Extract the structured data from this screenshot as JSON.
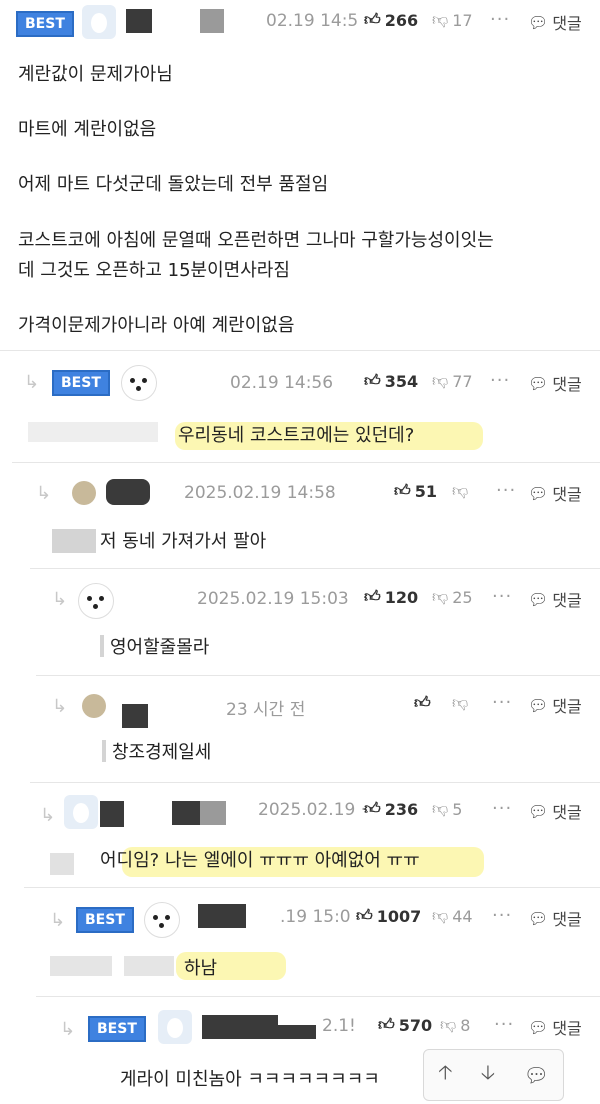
{
  "comments": [
    {
      "badge": "BEST",
      "time": "02.19 14:5",
      "likes": "266",
      "dislikes": "17",
      "more": "···",
      "reply": "댓글",
      "lines": [
        "계란값이 문제가아님",
        "마트에 계란이없음",
        "어제 마트 다섯군데 돌았는데 전부 품절임",
        "코스트코에 아침에 문열때 오픈런하면 그나마 구할가능성이잇는",
        "데 그것도 오픈하고 15분이면사라짐",
        "가격이문제가아니라 아예 계란이없음"
      ]
    },
    {
      "badge": "BEST",
      "time": "02.19 14:56",
      "likes": "354",
      "dislikes": "77",
      "more": "···",
      "reply": "댓글",
      "text": "우리동네 코스트코에는 있던데?"
    },
    {
      "time": "2025.02.19 14:58",
      "likes": "51",
      "dislikes": "",
      "more": "···",
      "reply": "댓글",
      "text": "저 동네 가져가서 팔아"
    },
    {
      "time": "2025.02.19 15:03",
      "likes": "120",
      "dislikes": "25",
      "more": "···",
      "reply": "댓글",
      "text": "영어할줄몰라"
    },
    {
      "time": "23 시간 전",
      "likes": "",
      "dislikes": "",
      "more": "···",
      "reply": "댓글",
      "text": "창조경제일세"
    },
    {
      "time": "2025.02.19 ·",
      "likes": "236",
      "dislikes": "5",
      "more": "···",
      "reply": "댓글",
      "text": "어디임? 나는 엘에이 ㅠㅠㅠ 아예없어 ㅠㅠ"
    },
    {
      "badge": "BEST",
      "time": ".19 15:0",
      "likes": "1007",
      "dislikes": "44",
      "more": "···",
      "reply": "댓글",
      "text": "하남"
    },
    {
      "badge": "BEST",
      "time": "2.1!",
      "likes": "570",
      "dislikes": "8",
      "more": "···",
      "reply": "댓글",
      "text": "게라이 미친놈아 ㅋㅋㅋㅋㅋㅋㅋㅋ"
    }
  ],
  "icons": {
    "like": "thumbs-up-icon",
    "dislike": "thumbs-down-icon",
    "reply": "speech-bubble-icon",
    "reply_arrow": "reply-arrow-icon",
    "up": "arrow-up-icon",
    "down": "arrow-down-icon",
    "chat": "chat-icon"
  },
  "colors": {
    "badge": "#3f82e0",
    "highlight": "#fbf49a"
  }
}
